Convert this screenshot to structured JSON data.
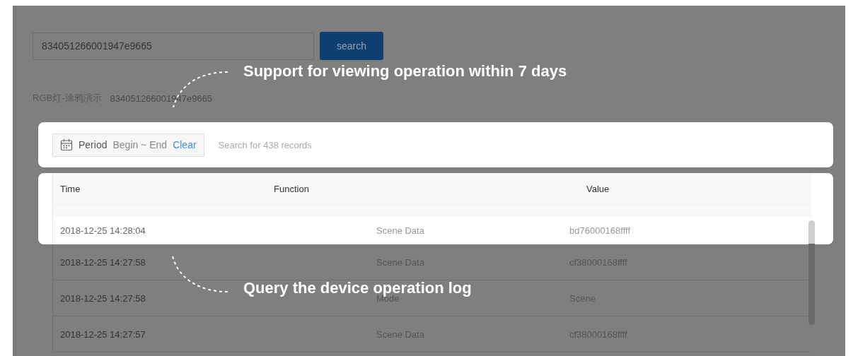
{
  "search": {
    "value": "834051266001947e9665",
    "button": "search"
  },
  "device": {
    "name": "RGB灯-涂鸦演示",
    "id": "834051266001947e9665"
  },
  "filter": {
    "label": "Period",
    "range": "Begin ~ End",
    "clear": "Clear",
    "summary": "Search for 438 records"
  },
  "table": {
    "columns": [
      "Time",
      "Function",
      "Value"
    ],
    "rows": [
      {
        "time": "2018-12-25 14:28:04",
        "function": "Scene Data",
        "value": "bd76000168ffff",
        "spotlight": true
      },
      {
        "time": "2018-12-25 14:27:58",
        "function": "Scene Data",
        "value": "cf38000168ffff",
        "spotlight": false
      },
      {
        "time": "2018-12-25 14:27:58",
        "function": "Mode",
        "value": "Scene",
        "spotlight": false
      },
      {
        "time": "2018-12-25 14:27:57",
        "function": "Scene Data",
        "value": "cf38000168ffff",
        "spotlight": false
      }
    ]
  },
  "annotations": [
    {
      "text": "Support for viewing operation within 7 days",
      "kind": "up"
    },
    {
      "text": "Query the device operation log",
      "kind": "down"
    }
  ]
}
